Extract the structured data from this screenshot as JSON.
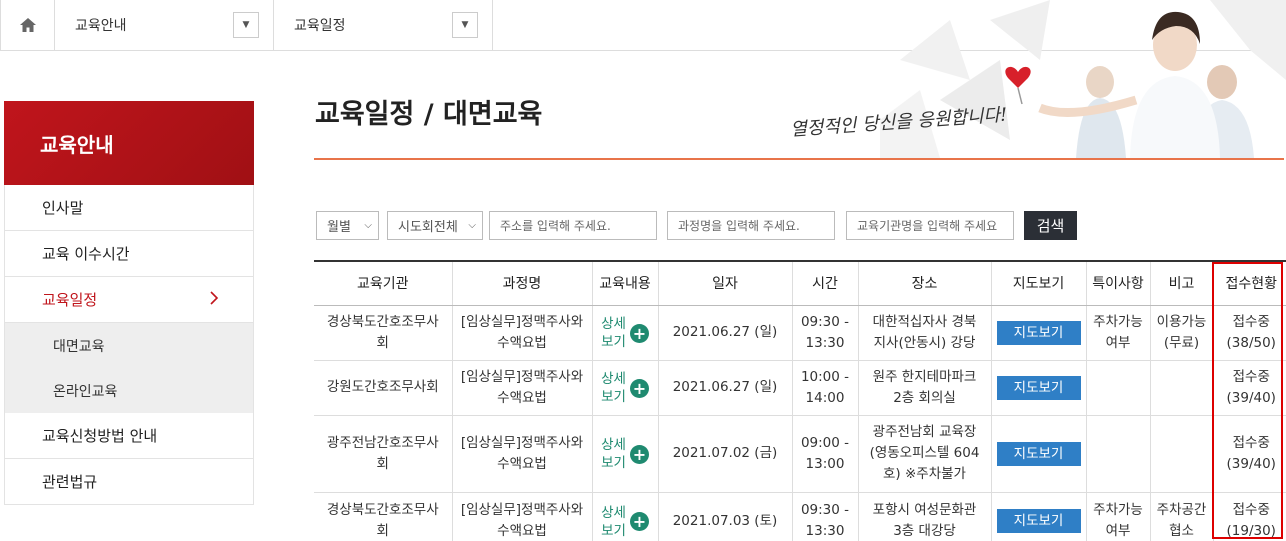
{
  "breadcrumb": {
    "home_icon": "home-icon",
    "level1": "교육안내",
    "level2": "교육일정"
  },
  "hero": {
    "slogan": "열정적인 당신을 응원합니다!"
  },
  "sidebar": {
    "title": "교육안내",
    "items": [
      {
        "label": "인사말"
      },
      {
        "label": "교육 이수시간"
      },
      {
        "label": "교육일정"
      },
      {
        "label": "교육신청방법 안내"
      },
      {
        "label": "관련법규"
      }
    ],
    "sub_items": [
      {
        "label": "대면교육"
      },
      {
        "label": "온라인교육"
      }
    ]
  },
  "page": {
    "title": "교육일정 / 대면교육"
  },
  "search": {
    "month_select": "월별",
    "region_select": "시도회전체",
    "address_placeholder": "주소를 입력해 주세요.",
    "course_placeholder": "과정명을 입력해 주세요.",
    "institution_placeholder": "교육기관명을 입력해 주세요",
    "button": "검색"
  },
  "table": {
    "headers": [
      "교육기관",
      "과정명",
      "교육내용",
      "일자",
      "시간",
      "장소",
      "지도보기",
      "특이사항",
      "비고",
      "접수현황"
    ],
    "detail_label_1": "상세",
    "detail_label_2": "보기",
    "map_button": "지도보기",
    "rows": [
      {
        "institution_1": "경상북도간호조무사",
        "institution_2": "회",
        "course_1": "[임상실무]정맥주사와",
        "course_2": "수액요법",
        "date": "2021.06.27 (일)",
        "time_1": "09:30 -",
        "time_2": "13:30",
        "place_1": "대한적십자사 경북",
        "place_2": "지사(안동시) 강당",
        "place_3": "",
        "note_1": "주차가능",
        "note_2": "여부",
        "remark_1": "이용가능",
        "remark_2": "(무료)",
        "status_1": "접수중",
        "status_2": "(38/50)"
      },
      {
        "institution_1": "강원도간호조무사회",
        "institution_2": "",
        "course_1": "[임상실무]정맥주사와",
        "course_2": "수액요법",
        "date": "2021.06.27 (일)",
        "time_1": "10:00 -",
        "time_2": "14:00",
        "place_1": "원주 한지테마파크",
        "place_2": "2층 회의실",
        "place_3": "",
        "note_1": "",
        "note_2": "",
        "remark_1": "",
        "remark_2": "",
        "status_1": "접수중",
        "status_2": "(39/40)"
      },
      {
        "institution_1": "광주전남간호조무사",
        "institution_2": "회",
        "course_1": "[임상실무]정맥주사와",
        "course_2": "수액요법",
        "date": "2021.07.02 (금)",
        "time_1": "09:00 -",
        "time_2": "13:00",
        "place_1": "광주전남회 교육장",
        "place_2": "(영동오피스텔 604",
        "place_3": "호) ※주차불가",
        "note_1": "",
        "note_2": "",
        "remark_1": "",
        "remark_2": "",
        "status_1": "접수중",
        "status_2": "(39/40)"
      },
      {
        "institution_1": "경상북도간호조무사",
        "institution_2": "회",
        "course_1": "[임상실무]정맥주사와",
        "course_2": "수액요법",
        "date": "2021.07.03 (토)",
        "time_1": "09:30 -",
        "time_2": "13:30",
        "place_1": "포항시 여성문화관",
        "place_2": "3층 대강당",
        "place_3": "",
        "note_1": "주차가능",
        "note_2": "여부",
        "remark_1": "주차공간",
        "remark_2": "협소",
        "status_1": "접수중",
        "status_2": "(19/30)"
      }
    ]
  },
  "colors": {
    "brand_red": "#c0151c",
    "accent_orange": "#e8744a",
    "map_blue": "#2f7fc6",
    "detail_green": "#1f8a70",
    "highlight_red": "#dd0000"
  }
}
